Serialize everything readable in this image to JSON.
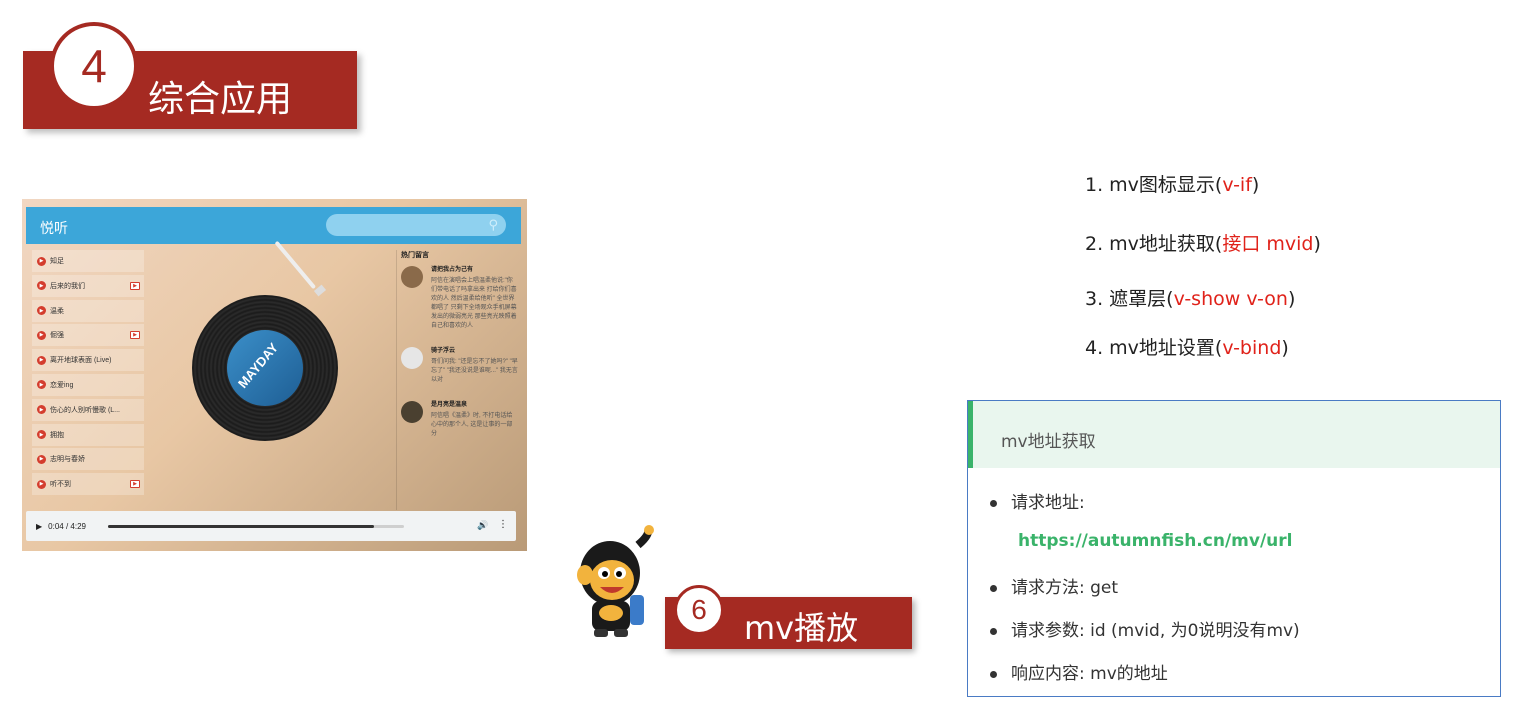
{
  "section": {
    "number": "4",
    "title": "综合应用"
  },
  "app": {
    "logo": "悦听",
    "search_icon": "⚲",
    "songs": [
      {
        "title": "知足",
        "has_mv": false
      },
      {
        "title": "后来的我们",
        "has_mv": true
      },
      {
        "title": "温柔",
        "has_mv": false
      },
      {
        "title": "倔强",
        "has_mv": true
      },
      {
        "title": "离开地球表面 (Live)",
        "has_mv": false
      },
      {
        "title": "恋爱ing",
        "has_mv": false
      },
      {
        "title": "伤心的人别听慢歌 (L...",
        "has_mv": false
      },
      {
        "title": "拥抱",
        "has_mv": false
      },
      {
        "title": "志明与春娇",
        "has_mv": false
      },
      {
        "title": "听不到",
        "has_mv": true
      }
    ],
    "comments_title": "热门留言",
    "comments": [
      {
        "name": "请把我占为己有",
        "text": "阿信在演唱会上唱温柔他说:\"你们带电话了吗拿出来 打给你们喜欢的人 然后温柔给他听\" 全世界都唱了 只剩下全场观众手机屏幕发出的微弱亮光 那些亮光映照着自己和喜欢的人"
      },
      {
        "name": "骑子浮云",
        "text": "哥们问我: \"还是忘不了她吗?\" \"早忘了\" \"我还没说是谁呢...\" 我无言以对"
      },
      {
        "name": "是月亮是温泉",
        "text": "阿信唱《温柔》时, 不打电话给心中的那个人, 这是让事的一部分"
      }
    ],
    "player": {
      "time": "0:04 / 4:29",
      "progress": 0.9
    },
    "album_text": "MAYDAY"
  },
  "mv_section": {
    "number": "6",
    "title": "mv播放"
  },
  "steps": [
    {
      "prefix": "1. mv图标显示(",
      "highlight": "v-if",
      "suffix": ")"
    },
    {
      "prefix": "2. mv地址获取(",
      "highlight": "接口 mvid",
      "suffix": ")"
    },
    {
      "prefix": "3. 遮罩层(",
      "highlight": "v-show v-on",
      "suffix": ")"
    },
    {
      "prefix": "4. mv地址设置(",
      "highlight": "v-bind",
      "suffix": ")"
    }
  ],
  "card": {
    "title": "mv地址获取",
    "items": [
      "请求地址:",
      "请求方法: get",
      "请求参数: id (mvid, 为0说明没有mv)",
      "响应内容: mv的地址"
    ],
    "url": "https://autumnfish.cn/mv/url"
  },
  "colors": {
    "brand_red": "#a52a22",
    "highlight_red": "#e0221a",
    "link_green": "#3ab36a",
    "header_blue": "#3ca6d9"
  }
}
